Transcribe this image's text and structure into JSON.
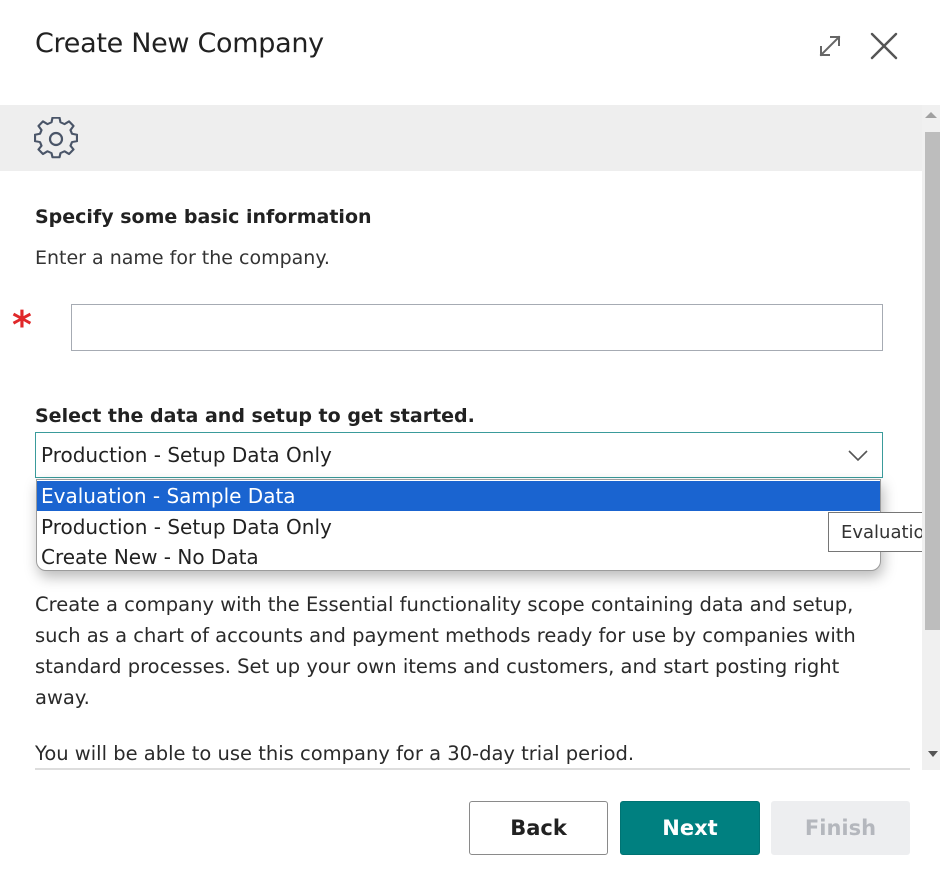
{
  "dialog": {
    "title": "Create New Company",
    "expand_icon": "expand-diagonal-arrows-icon",
    "close_icon": "close-x-icon",
    "banner_icon": "gear-icon"
  },
  "basic_info": {
    "heading": "Specify some basic information",
    "instruction": "Enter a name for the company.",
    "required_marker": "*",
    "company_name_value": ""
  },
  "data_setup": {
    "label": "Select the data and setup to get started.",
    "selected_value": "Production - Setup Data Only",
    "options": [
      {
        "label": "Evaluation - Sample Data",
        "highlighted": true
      },
      {
        "label": "Production - Setup Data Only",
        "highlighted": false
      },
      {
        "label": "Create New - No Data",
        "highlighted": false
      }
    ],
    "tooltip": "Evaluation - Sample Data"
  },
  "description": {
    "paragraph": "Create a company with the Essential functionality scope containing data and setup, such as a chart of accounts and payment methods ready for use by companies with standard processes. Set up your own items and customers, and start posting right away.",
    "trial_note": "You will be able to use this company for a 30-day trial period."
  },
  "footer": {
    "back_label": "Back",
    "next_label": "Next",
    "finish_label": "Finish",
    "finish_enabled": false
  },
  "colors": {
    "accent": "#008080",
    "selection": "#1a64d0",
    "required": "#e0282a"
  }
}
